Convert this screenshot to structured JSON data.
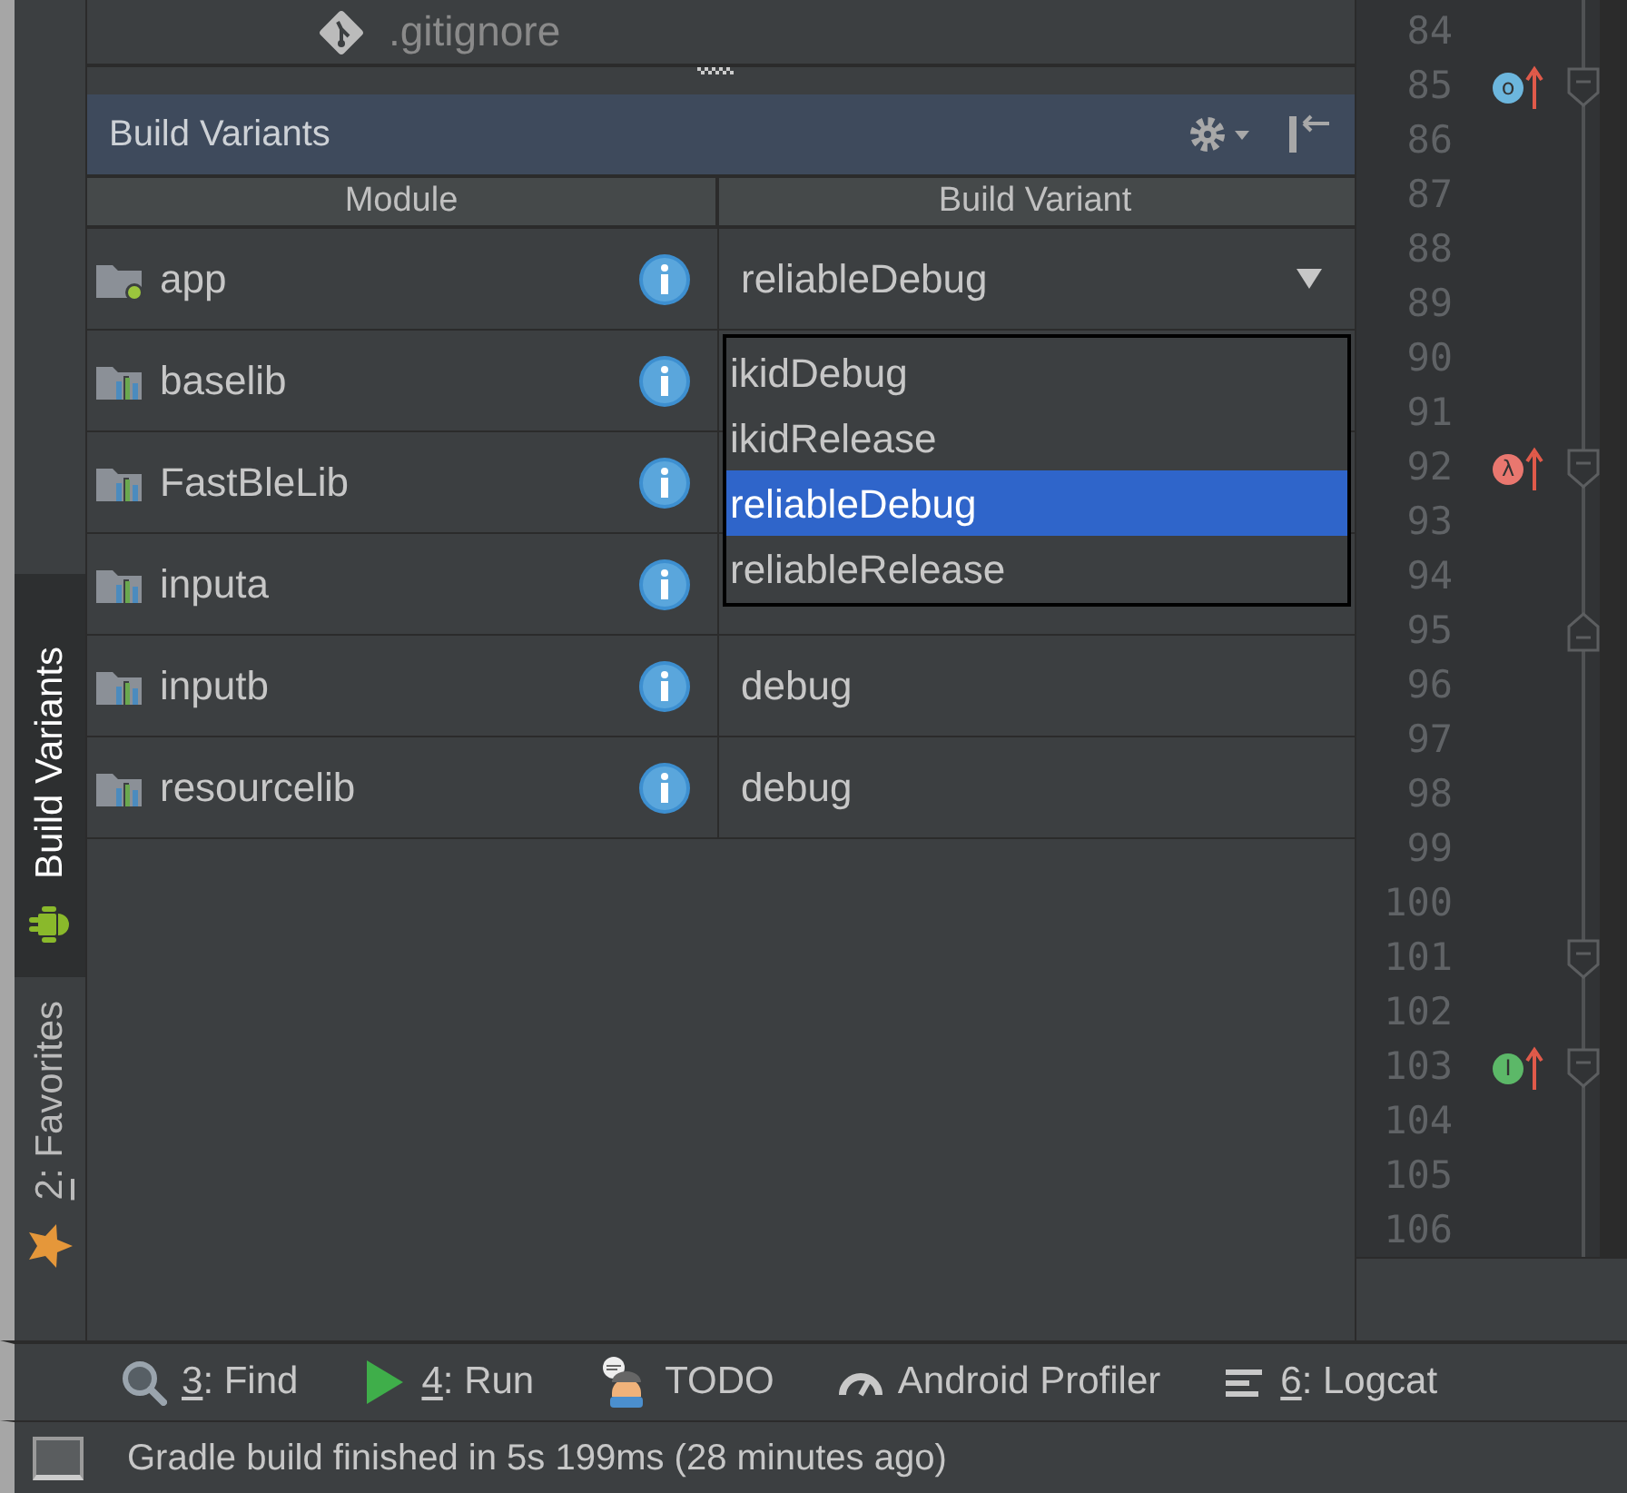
{
  "project_file": {
    "name": ".gitignore"
  },
  "side_tabs": [
    {
      "label": "Build Variants",
      "selected": true
    },
    {
      "key": "2",
      "label": ": Favorites",
      "selected": false
    }
  ],
  "panel": {
    "title": "Build Variants"
  },
  "table": {
    "columns": [
      "Module",
      "Build Variant"
    ],
    "rows": [
      {
        "module": "app",
        "kind": "app",
        "variant": "reliableDebug",
        "dropdown": true
      },
      {
        "module": "baselib",
        "kind": "lib"
      },
      {
        "module": "FastBleLib",
        "kind": "lib"
      },
      {
        "module": "inputa",
        "kind": "lib"
      },
      {
        "module": "inputb",
        "kind": "lib",
        "variant": "debug",
        "dropdown": false
      },
      {
        "module": "resourcelib",
        "kind": "lib",
        "variant": "debug",
        "dropdown": false
      }
    ]
  },
  "variant_menu": [
    {
      "label": "ikidDebug",
      "selected": false
    },
    {
      "label": "ikidRelease",
      "selected": false
    },
    {
      "label": "reliableDebug",
      "selected": true
    },
    {
      "label": "reliableRelease",
      "selected": false
    }
  ],
  "editor_lines": [
    {
      "number": "84"
    },
    {
      "number": "85",
      "badge": {
        "text": "o",
        "color": "#6cb6dd"
      },
      "kind": "fold_start"
    },
    {
      "number": "86"
    },
    {
      "number": "87"
    },
    {
      "number": "88"
    },
    {
      "number": "89"
    },
    {
      "number": "90"
    },
    {
      "number": "91"
    },
    {
      "number": "92",
      "badge": {
        "text": "λ",
        "color": "#e9776f"
      },
      "kind": "fold_start"
    },
    {
      "number": "93"
    },
    {
      "number": "94"
    },
    {
      "number": "95",
      "kind": "fold_end"
    },
    {
      "number": "96"
    },
    {
      "number": "97"
    },
    {
      "number": "98"
    },
    {
      "number": "99"
    },
    {
      "number": "100"
    },
    {
      "number": "101",
      "kind": "fold_start"
    },
    {
      "number": "102"
    },
    {
      "number": "103",
      "badge": {
        "text": "I",
        "color": "#5cb868"
      },
      "kind": "fold_start"
    },
    {
      "number": "104"
    },
    {
      "number": "105"
    },
    {
      "number": "106"
    }
  ],
  "tool_windows": [
    {
      "key": "3",
      "label": ": Find"
    },
    {
      "key": "4",
      "label": ": Run"
    },
    {
      "label": "TODO"
    },
    {
      "label": "Android Profiler"
    },
    {
      "key": "6",
      "label": ": Logcat"
    }
  ],
  "status_bar": {
    "message": "Gradle build finished in 5s 199ms (28 minutes ago)"
  }
}
